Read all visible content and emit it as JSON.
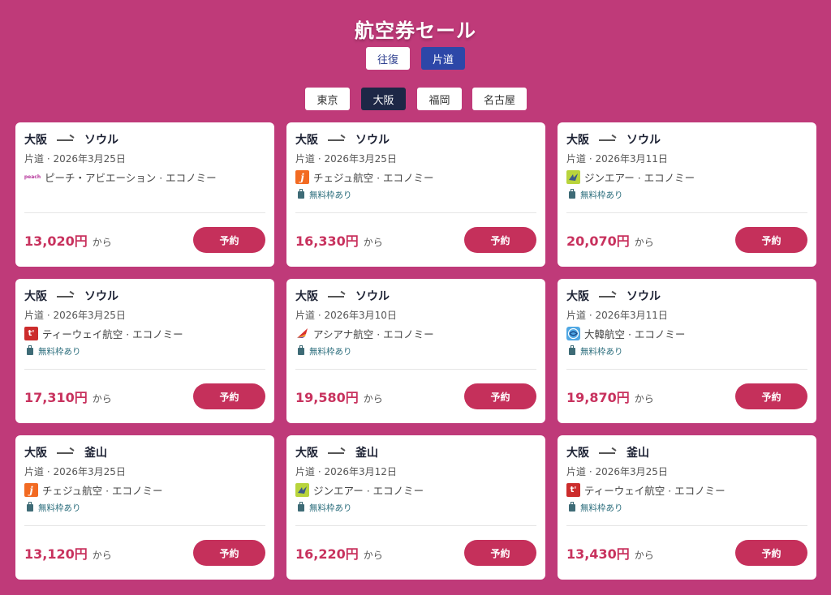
{
  "page": {
    "title": "航空券セール"
  },
  "trip_types": [
    {
      "label": "往復",
      "selected": false
    },
    {
      "label": "片道",
      "selected": true
    }
  ],
  "origins": [
    {
      "label": "東京",
      "selected": false
    },
    {
      "label": "大阪",
      "selected": true
    },
    {
      "label": "福岡",
      "selected": false
    },
    {
      "label": "名古屋",
      "selected": false
    }
  ],
  "colors": {
    "background": "#bf3a79",
    "accent": "#c5305b",
    "tab_selected": "#2d47a8",
    "city_selected": "#1d2746"
  },
  "cards": [
    {
      "from": "大阪",
      "to": "ソウル",
      "meta": "片道 · 2026年3月25日",
      "logo": "peach-logo",
      "logo_text": "peach",
      "airline": "ピーチ・アビエーション · エコノミー",
      "baggage": "",
      "price": "13,020円",
      "suffix": "から",
      "button": "予約"
    },
    {
      "from": "大阪",
      "to": "ソウル",
      "meta": "片道 · 2026年3月25日",
      "logo": "jeju-logo",
      "logo_text": "j",
      "airline": "チェジュ航空 · エコノミー",
      "baggage": "無料枠あり",
      "price": "16,330円",
      "suffix": "から",
      "button": "予約"
    },
    {
      "from": "大阪",
      "to": "ソウル",
      "meta": "片道 · 2026年3月11日",
      "logo": "jinair-logo",
      "logo_text": "",
      "airline": "ジンエアー · エコノミー",
      "baggage": "無料枠あり",
      "price": "20,070円",
      "suffix": "から",
      "button": "予約"
    },
    {
      "from": "大阪",
      "to": "ソウル",
      "meta": "片道 · 2026年3月25日",
      "logo": "tway-logo",
      "logo_text": "t'",
      "airline": "ティーウェイ航空 · エコノミー",
      "baggage": "無料枠あり",
      "price": "17,310円",
      "suffix": "から",
      "button": "予約"
    },
    {
      "from": "大阪",
      "to": "ソウル",
      "meta": "片道 · 2026年3月10日",
      "logo": "asiana-logo",
      "logo_text": "",
      "airline": "アシアナ航空 · エコノミー",
      "baggage": "無料枠あり",
      "price": "19,580円",
      "suffix": "から",
      "button": "予約"
    },
    {
      "from": "大阪",
      "to": "ソウル",
      "meta": "片道 · 2026年3月11日",
      "logo": "korean-air-logo",
      "logo_text": "",
      "airline": "大韓航空 · エコノミー",
      "baggage": "無料枠あり",
      "price": "19,870円",
      "suffix": "から",
      "button": "予約"
    },
    {
      "from": "大阪",
      "to": "釜山",
      "meta": "片道 · 2026年3月25日",
      "logo": "jeju-logo",
      "logo_text": "j",
      "airline": "チェジュ航空 · エコノミー",
      "baggage": "無料枠あり",
      "price": "13,120円",
      "suffix": "から",
      "button": "予約"
    },
    {
      "from": "大阪",
      "to": "釜山",
      "meta": "片道 · 2026年3月12日",
      "logo": "jinair-logo",
      "logo_text": "",
      "airline": "ジンエアー · エコノミー",
      "baggage": "無料枠あり",
      "price": "16,220円",
      "suffix": "から",
      "button": "予約"
    },
    {
      "from": "大阪",
      "to": "釜山",
      "meta": "片道 · 2026年3月25日",
      "logo": "tway-logo",
      "logo_text": "t'",
      "airline": "ティーウェイ航空 · エコノミー",
      "baggage": "無料枠あり",
      "price": "13,430円",
      "suffix": "から",
      "button": "予約"
    }
  ]
}
